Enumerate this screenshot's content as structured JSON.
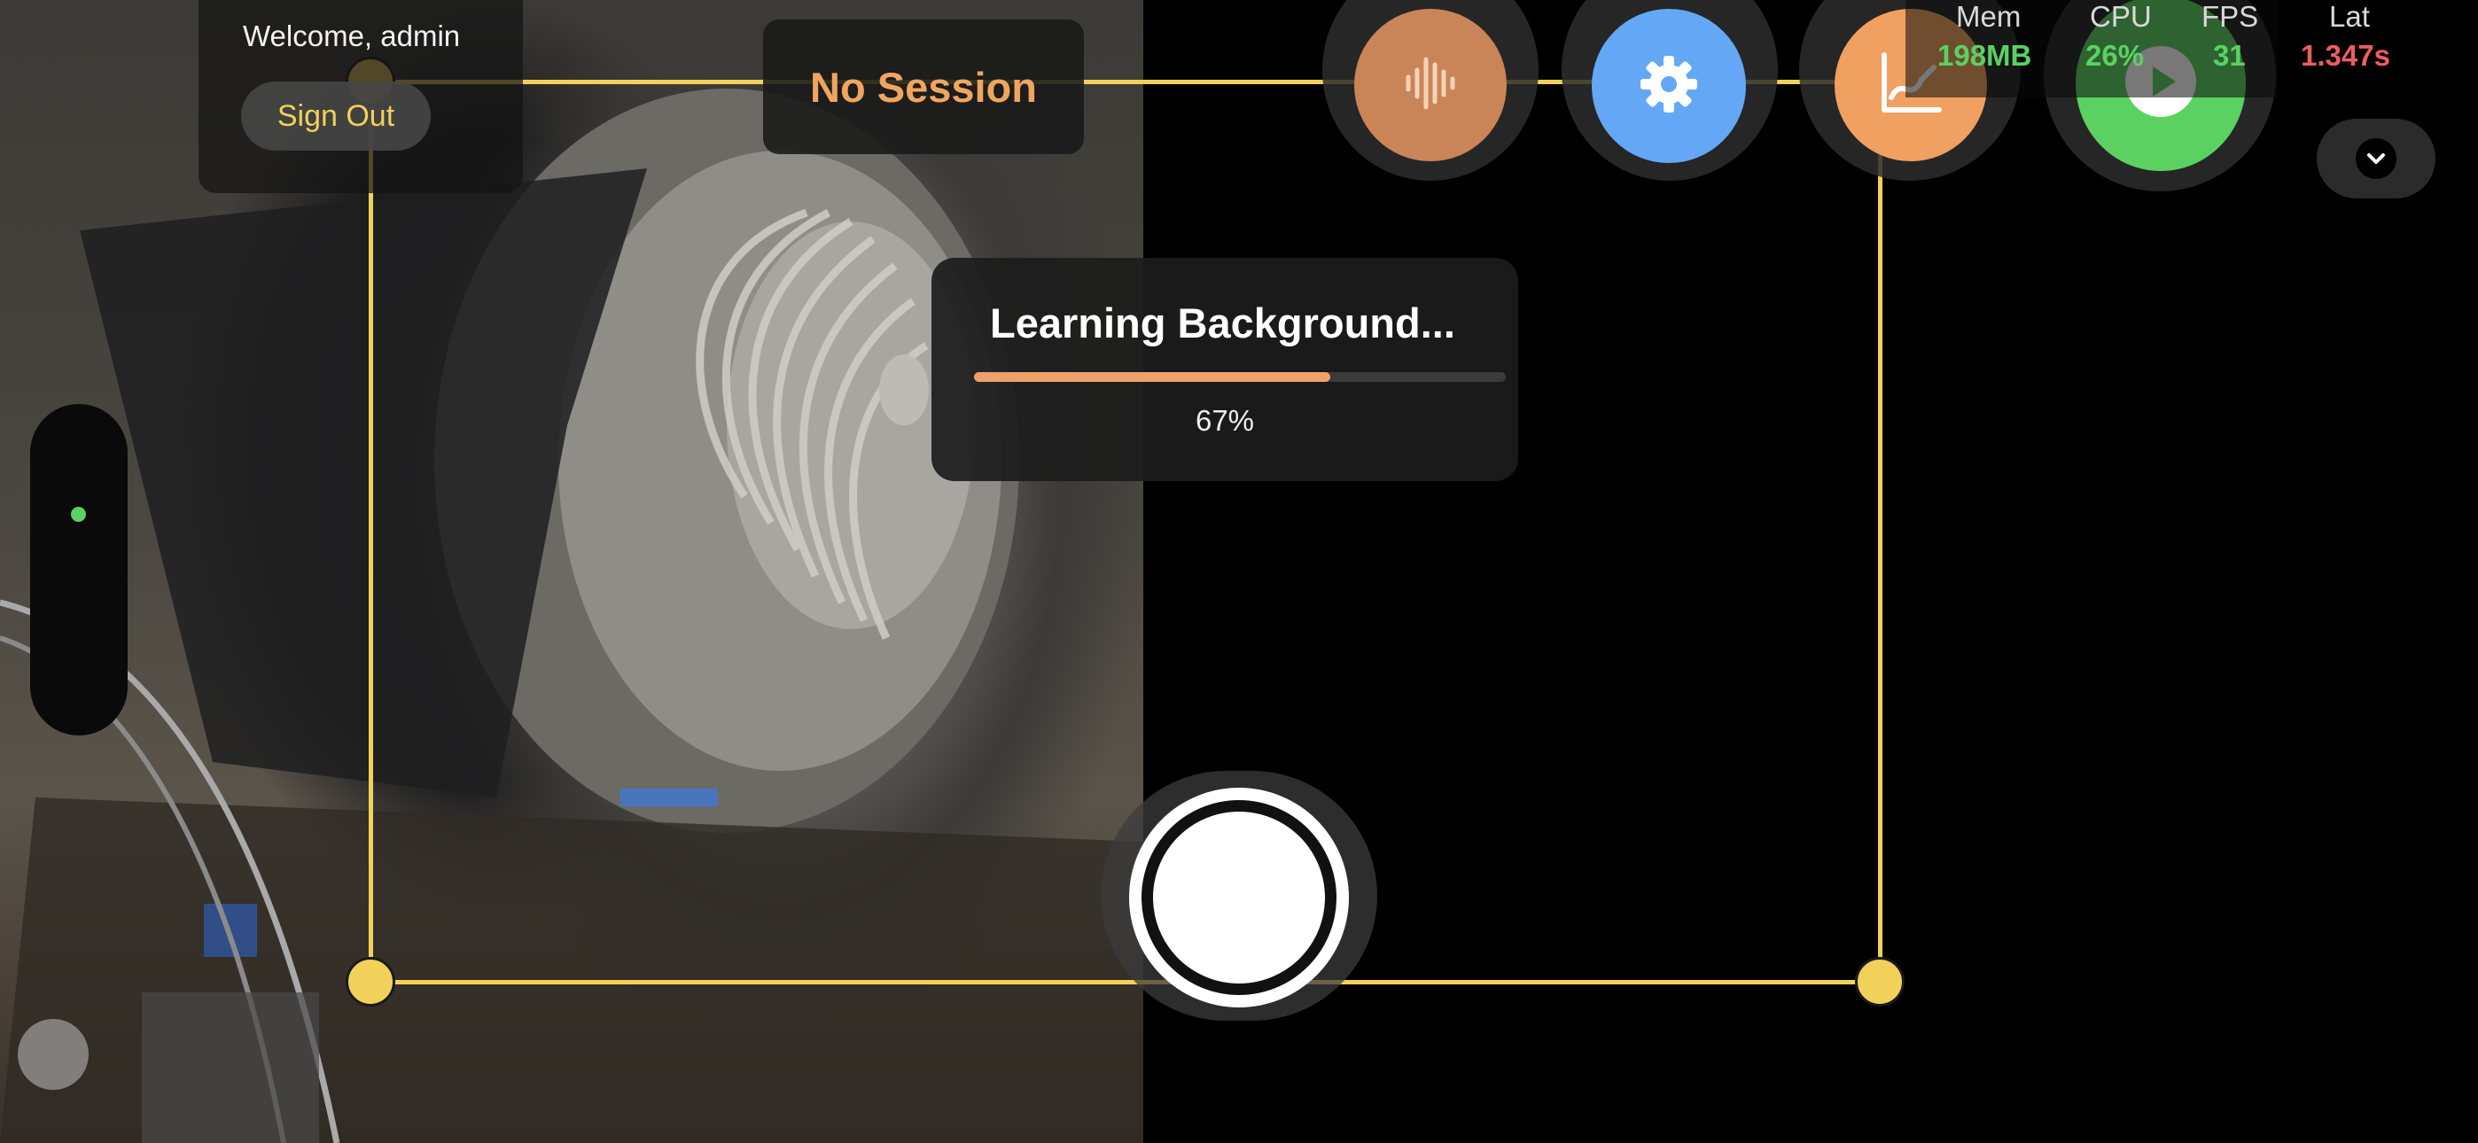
{
  "user": {
    "welcome": "Welcome, admin",
    "sign_out": "Sign Out"
  },
  "session": {
    "status": "No Session"
  },
  "learning": {
    "title": "Learning Background...",
    "progress_percent": 67,
    "percent_label": "67%"
  },
  "toolbar": {
    "buttons": [
      {
        "name": "audio-waveform",
        "icon": "waveform-icon",
        "color": "#c98558"
      },
      {
        "name": "settings",
        "icon": "gear-icon",
        "color": "#64a8f5"
      },
      {
        "name": "chart",
        "icon": "chart-icon",
        "color": "#f0a060"
      },
      {
        "name": "play",
        "icon": "play-icon",
        "color": "#5bd162"
      }
    ]
  },
  "metrics": {
    "mem": {
      "label": "Mem",
      "value": "198MB",
      "color": "#5bd162"
    },
    "cpu": {
      "label": "CPU",
      "value": "26%",
      "color": "#5bd162"
    },
    "fps": {
      "label": "FPS",
      "value": "31",
      "color": "#5bd162"
    },
    "lat": {
      "label": "Lat",
      "value": "1.347s",
      "color": "#ee5c62"
    }
  },
  "colors": {
    "selection": "#f2d15a",
    "accent_orange": "#f0a060"
  },
  "expand_icon": "chevron-down-icon",
  "side_indicator_icon": "status-dot-icon",
  "capture_icon": "shutter-icon"
}
